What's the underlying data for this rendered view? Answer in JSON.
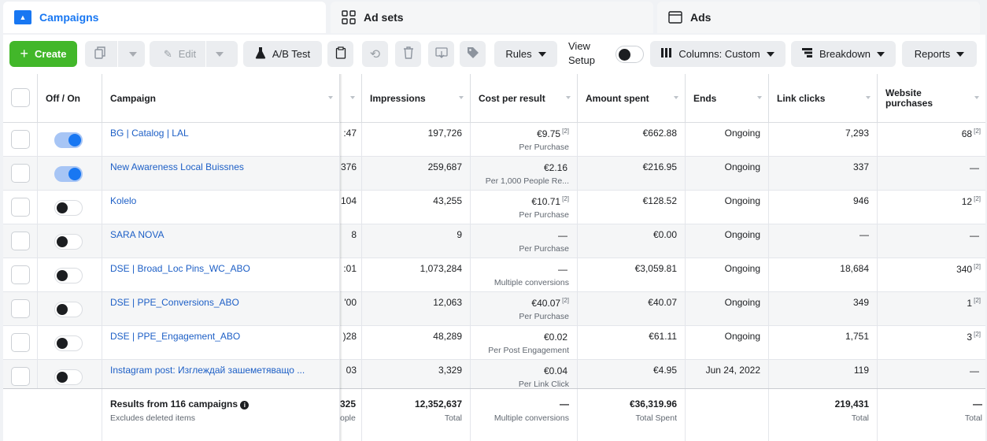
{
  "tabs": [
    {
      "label": "Campaigns",
      "icon": "campaign-icon"
    },
    {
      "label": "Ad sets",
      "icon": "grid-icon"
    },
    {
      "label": "Ads",
      "icon": "ad-icon"
    }
  ],
  "toolbar": {
    "create": "Create",
    "edit": "Edit",
    "ab_test": "A/B Test",
    "rules": "Rules",
    "view_setup_1": "View",
    "view_setup_2": "Setup",
    "columns": "Columns: Custom",
    "breakdown": "Breakdown",
    "reports": "Reports"
  },
  "columns": {
    "off_on": "Off / On",
    "campaign": "Campaign",
    "impressions": "Impressions",
    "cost_per_result": "Cost per result",
    "amount_spent": "Amount spent",
    "ends": "Ends",
    "link_clicks": "Link clicks",
    "website_purchases_1": "Website",
    "website_purchases_2": "purchases"
  },
  "rows": [
    {
      "name": "BG | Catalog | LAL",
      "on": true,
      "hidden": ":47",
      "impressions": "197,726",
      "cost": "€9.75",
      "cost_sup": "[2]",
      "cost_sub": "Per Purchase",
      "spent": "€662.88",
      "ends": "Ongoing",
      "clicks": "7,293",
      "purchases": "68",
      "purch_sup": "[2]"
    },
    {
      "name": "New Awareness Local Buissnes",
      "on": true,
      "hidden": "376",
      "impressions": "259,687",
      "cost": "€2.16",
      "cost_sup": "",
      "cost_sub": "Per 1,000 People Re...",
      "spent": "€216.95",
      "ends": "Ongoing",
      "clicks": "337",
      "purchases": "—",
      "purch_sup": ""
    },
    {
      "name": "Kolelo",
      "on": false,
      "hidden": "104",
      "impressions": "43,255",
      "cost": "€10.71",
      "cost_sup": "[2]",
      "cost_sub": "Per Purchase",
      "spent": "€128.52",
      "ends": "Ongoing",
      "clicks": "946",
      "purchases": "12",
      "purch_sup": "[2]"
    },
    {
      "name": "SARA NOVA",
      "on": false,
      "hidden": "8",
      "impressions": "9",
      "cost": "—",
      "cost_sup": "",
      "cost_sub": "Per Purchase",
      "spent": "€0.00",
      "ends": "Ongoing",
      "clicks": "—",
      "purchases": "—",
      "purch_sup": ""
    },
    {
      "name": "DSE | Broad_Loc Pins_WC_ABO",
      "on": false,
      "hidden": ":01",
      "impressions": "1,073,284",
      "cost": "—",
      "cost_sup": "",
      "cost_sub": "Multiple conversions",
      "spent": "€3,059.81",
      "ends": "Ongoing",
      "clicks": "18,684",
      "purchases": "340",
      "purch_sup": "[2]"
    },
    {
      "name": "DSE | PPE_Conversions_ABO",
      "on": false,
      "hidden": "'00",
      "impressions": "12,063",
      "cost": "€40.07",
      "cost_sup": "[2]",
      "cost_sub": "Per Purchase",
      "spent": "€40.07",
      "ends": "Ongoing",
      "clicks": "349",
      "purchases": "1",
      "purch_sup": "[2]"
    },
    {
      "name": "DSE | PPE_Engagement_ABO",
      "on": false,
      "hidden": ")28",
      "impressions": "48,289",
      "cost": "€0.02",
      "cost_sup": "",
      "cost_sub": "Per Post Engagement",
      "spent": "€61.11",
      "ends": "Ongoing",
      "clicks": "1,751",
      "purchases": "3",
      "purch_sup": "[2]"
    },
    {
      "name": "Instagram post: Изглеждай зашеметяващо ...",
      "on": false,
      "hidden": "03",
      "impressions": "3,329",
      "cost": "€0.04",
      "cost_sup": "",
      "cost_sub": "Per Link Click",
      "spent": "€4.95",
      "ends": "Jun 24, 2022",
      "clicks": "119",
      "purchases": "—",
      "purch_sup": ""
    }
  ],
  "footer": {
    "results": "Results from 116 campaigns",
    "excludes": "Excludes deleted items",
    "hidden_main": "325",
    "hidden_sub": "ople",
    "impressions": "12,352,637",
    "impressions_sub": "Total",
    "cost": "—",
    "cost_sub": "Multiple conversions",
    "spent": "€36,319.96",
    "spent_sub": "Total Spent",
    "clicks": "219,431",
    "clicks_sub": "Total",
    "purchases": "—",
    "purchases_sub": "Total"
  },
  "colors": {
    "accent": "#1877f2",
    "create": "#42b72a",
    "link": "#1d5fc6"
  }
}
